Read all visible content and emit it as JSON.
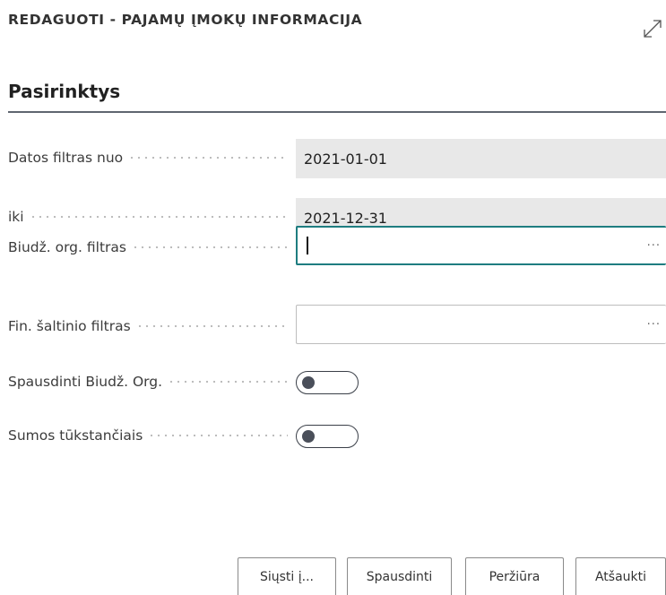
{
  "dialog": {
    "title": "REDAGUOTI - PAJAMŲ ĮMOKŲ INFORMACIJA",
    "expand_icon": "expand-arrows-icon"
  },
  "section": {
    "title": "Pasirinktys"
  },
  "fields": {
    "date_from": {
      "label": "Datos filtras nuo",
      "value": "2021-01-01"
    },
    "date_to": {
      "label": "iki",
      "value": "2021-12-31"
    },
    "budget_org_filter": {
      "label": "Biudž. org. filtras",
      "value": "",
      "lookup": "···"
    },
    "fin_source_filter": {
      "label": "Fin. šaltinio filtras",
      "value": "",
      "lookup": "···"
    },
    "print_budget_org": {
      "label": "Spausdinti Biudž. Org.",
      "checked": false
    },
    "amounts_thousands": {
      "label": "Sumos tūkstančiais",
      "checked": false
    }
  },
  "buttons": {
    "send_to": "Siųsti į...",
    "print": "Spausdinti",
    "preview": "Peržiūra",
    "cancel": "Atšaukti"
  }
}
